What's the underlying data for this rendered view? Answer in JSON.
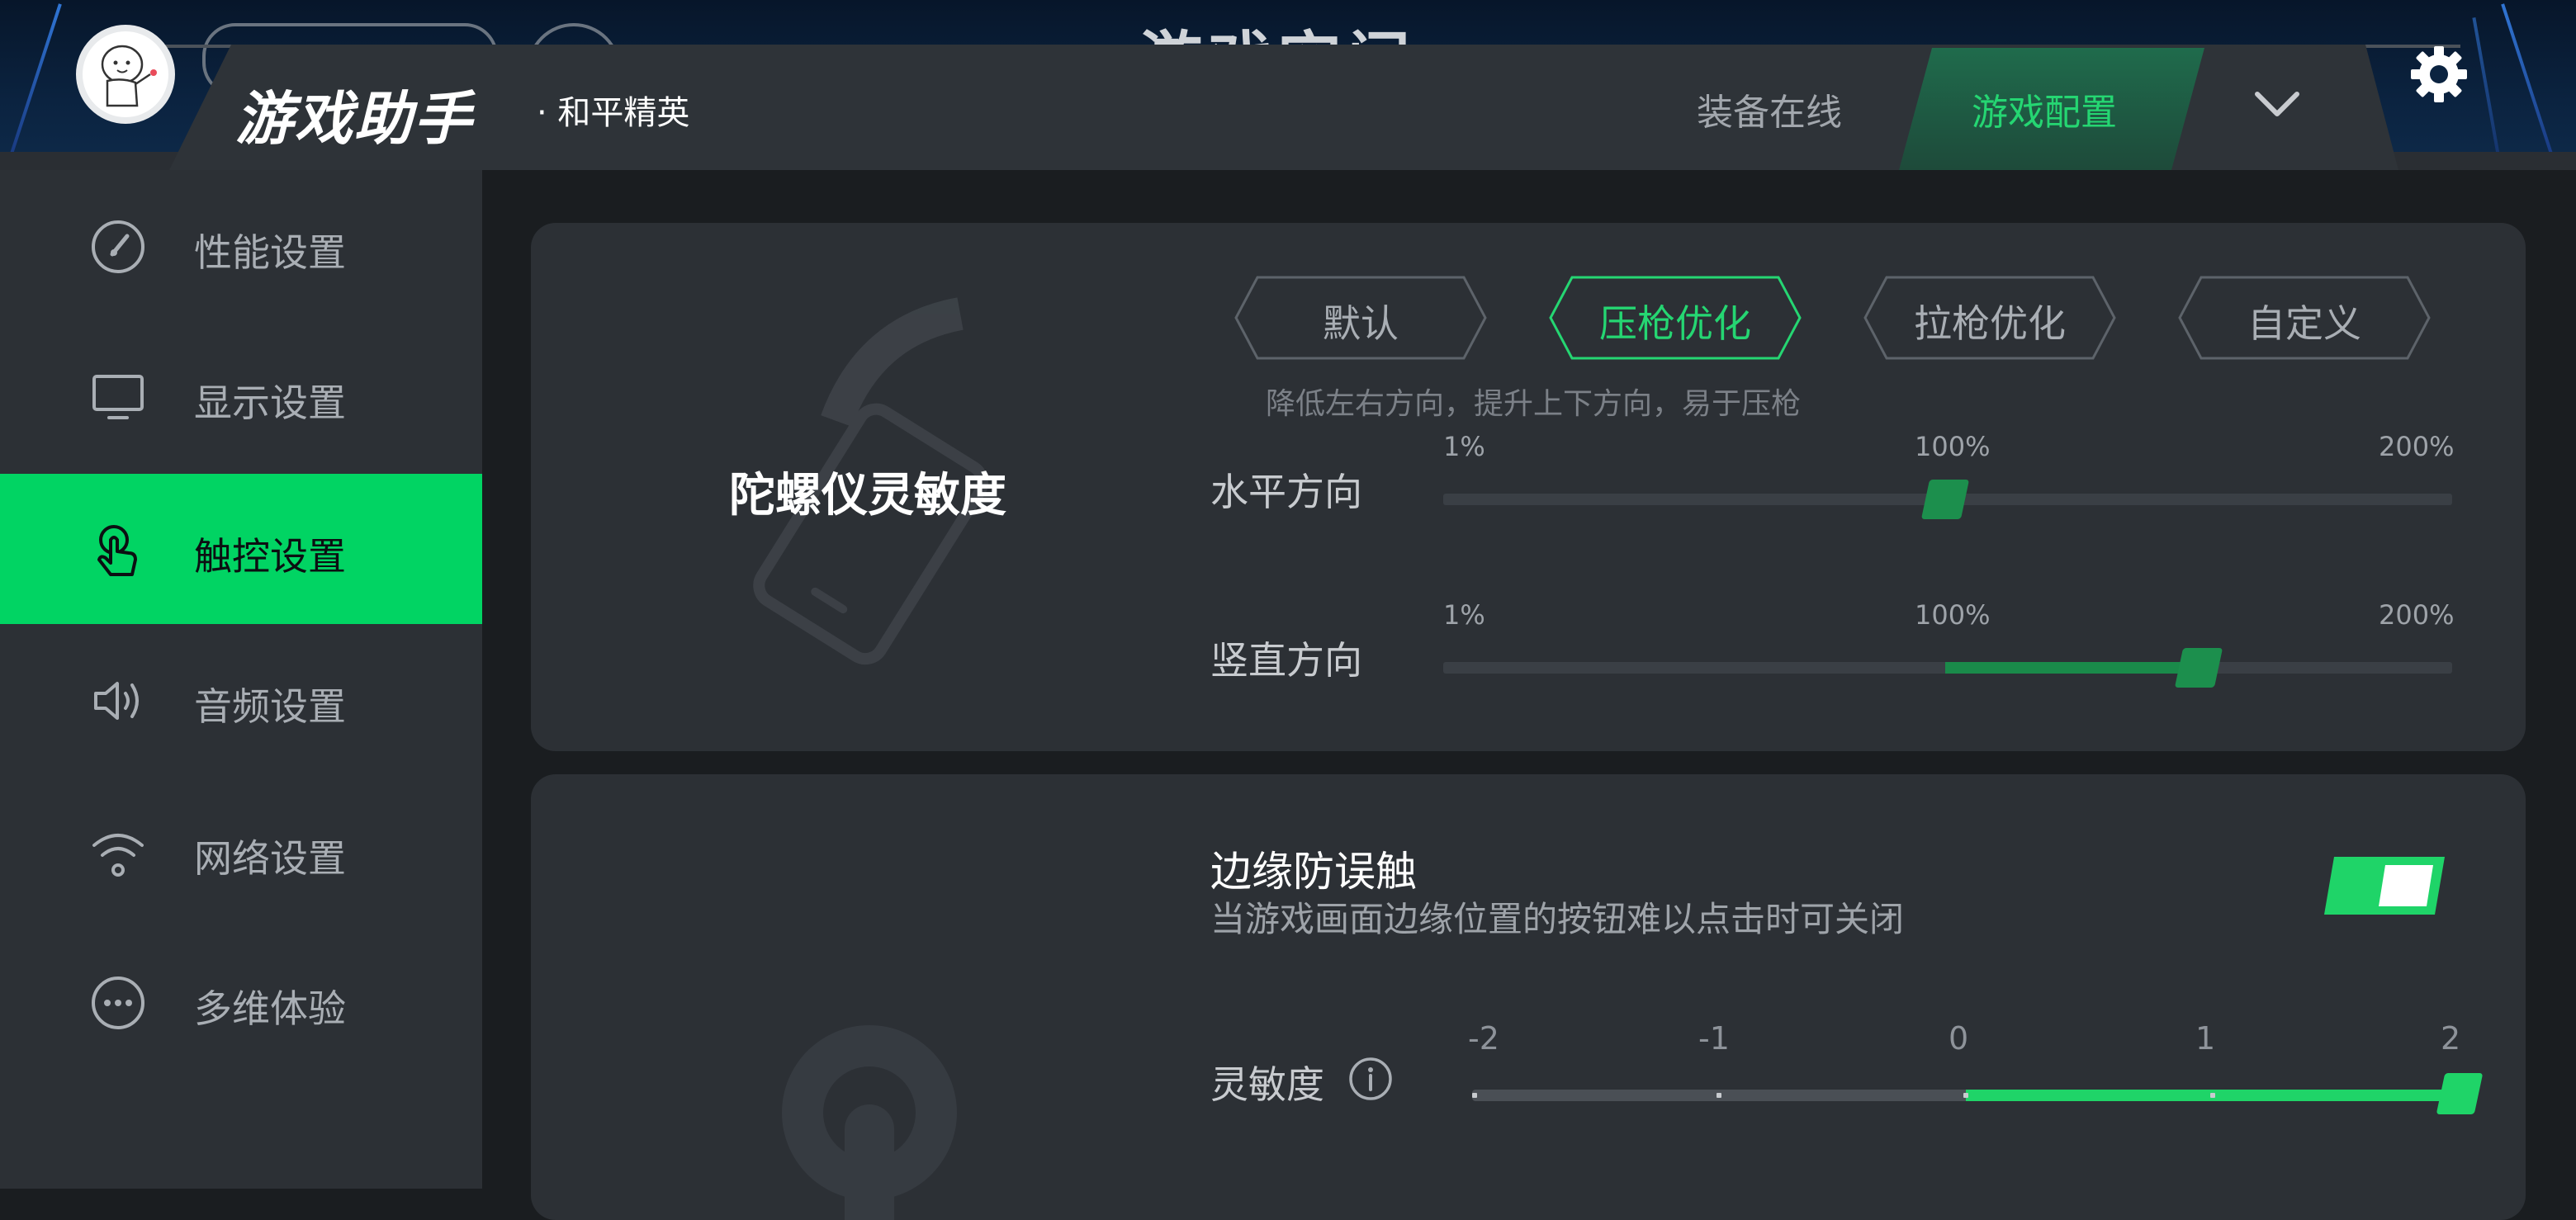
{
  "header": {
    "app_title": "游戏助手",
    "game_name": "· 和平精英",
    "background_title_peek": "游戏空间",
    "tabs": [
      {
        "label": "装备在线",
        "active": false
      },
      {
        "label": "游戏配置",
        "active": true
      }
    ],
    "icons": {
      "expand": "chevron-down-icon",
      "settings": "gear-icon",
      "avatar": "avatar"
    }
  },
  "sidebar": {
    "items": [
      {
        "label": "性能设置",
        "icon": "speedometer-icon",
        "active": false
      },
      {
        "label": "显示设置",
        "icon": "monitor-icon",
        "active": false
      },
      {
        "label": "触控设置",
        "icon": "touch-hand-icon",
        "active": true
      },
      {
        "label": "音频设置",
        "icon": "speaker-icon",
        "active": false
      },
      {
        "label": "网络设置",
        "icon": "wifi-icon",
        "active": false
      },
      {
        "label": "多维体验",
        "icon": "more-dots-icon",
        "active": false
      }
    ]
  },
  "gyro": {
    "title": "陀螺仪灵敏度",
    "presets": [
      {
        "label": "默认",
        "active": false
      },
      {
        "label": "压枪优化",
        "active": true
      },
      {
        "label": "拉枪优化",
        "active": false
      },
      {
        "label": "自定义",
        "active": false
      }
    ],
    "preset_description": "降低左右方向，提升上下方向，易于压枪",
    "horizontal": {
      "label": "水平方向",
      "min_label": "1%",
      "mid_label": "100%",
      "max_label": "200%",
      "value_percent": 100
    },
    "vertical": {
      "label": "竖直方向",
      "min_label": "1%",
      "mid_label": "100%",
      "max_label": "200%",
      "value_percent": 150
    }
  },
  "edge": {
    "title": "边缘防误触",
    "description": "当游戏画面边缘位置的按钮难以点击时可关闭",
    "enabled": true,
    "sensitivity": {
      "label": "灵敏度",
      "ticks": [
        "-2",
        "-1",
        "0",
        "1",
        "2"
      ],
      "value": 2
    }
  },
  "colors": {
    "accent": "#01d463",
    "accent_text": "#25d672",
    "panel": "#2c3035",
    "page": "#1a1d20"
  }
}
